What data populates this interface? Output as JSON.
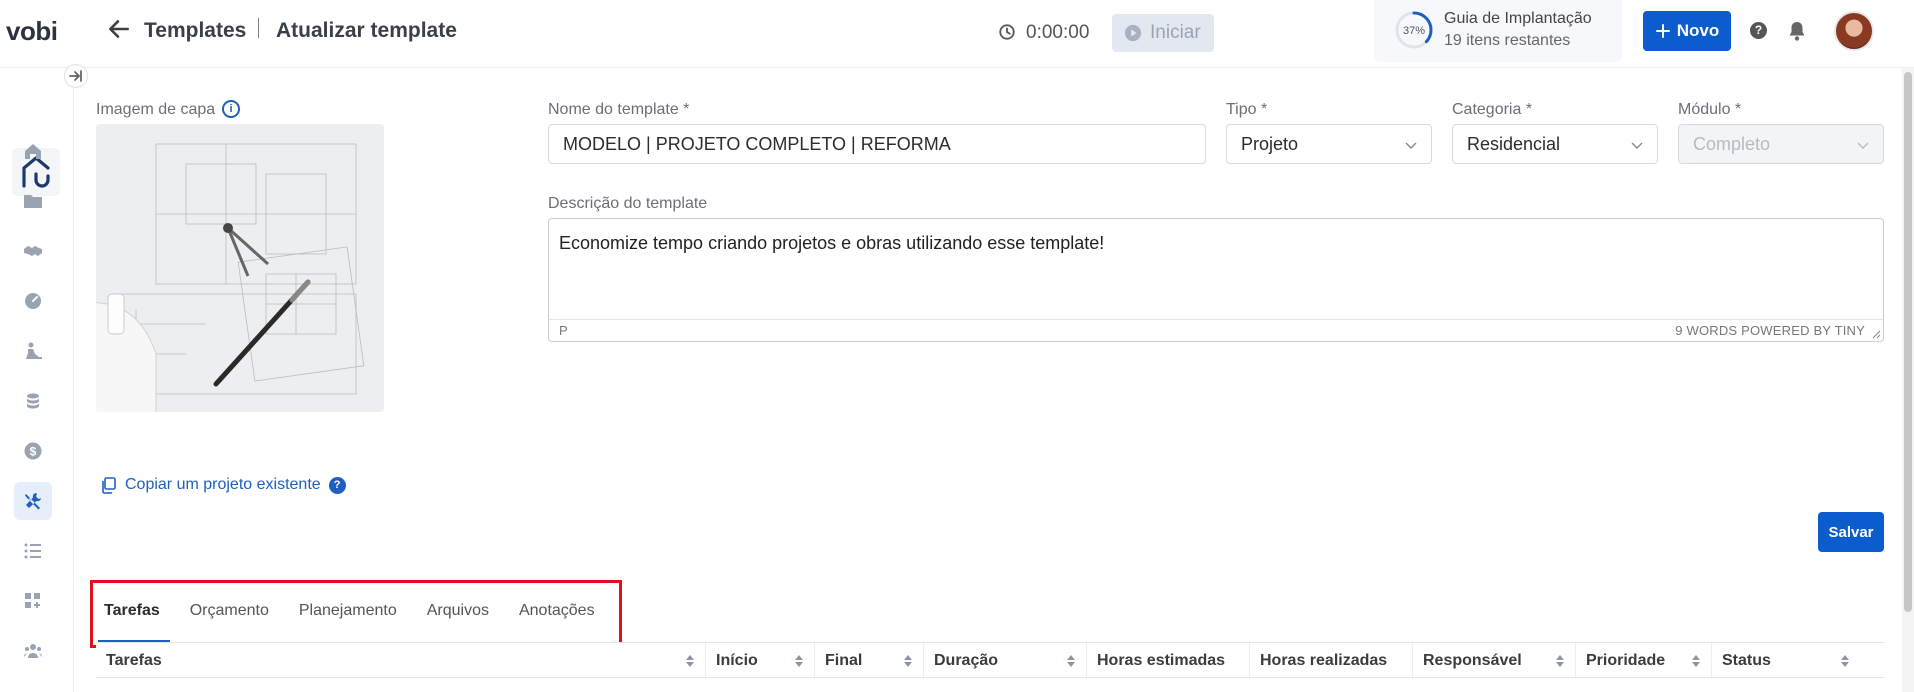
{
  "header": {
    "logo": "vobi",
    "breadcrumb": [
      "Templates",
      "Atualizar template"
    ],
    "timer": "0:00:00",
    "start_label": "Iniciar",
    "guide": {
      "percent": "37%",
      "progress": 0.37,
      "title": "Guia de Implantação",
      "subtitle": "19 itens restantes"
    },
    "new_label": "Novo",
    "help_label": "?"
  },
  "sidebar": {
    "items": [
      {
        "icon": "home-icon"
      },
      {
        "icon": "folder-icon"
      },
      {
        "icon": "handshake-icon"
      },
      {
        "icon": "gauge-icon"
      },
      {
        "icon": "worker-icon"
      },
      {
        "icon": "coins-icon"
      },
      {
        "icon": "dollar-icon"
      },
      {
        "icon": "tools-icon",
        "active": true
      },
      {
        "icon": "list-icon"
      },
      {
        "icon": "apps-add-icon"
      },
      {
        "icon": "team-icon"
      }
    ]
  },
  "form": {
    "cover_label": "Imagem de capa",
    "name_label": "Nome do template *",
    "name_value": "MODELO | PROJETO COMPLETO | REFORMA",
    "type_label": "Tipo *",
    "type_value": "Projeto",
    "category_label": "Categoria *",
    "category_value": "Residencial",
    "module_label": "Módulo *",
    "module_value": "Completo",
    "description_label": "Descrição do template",
    "description_value": "Economize tempo criando projetos e obras utilizando esse template!",
    "editor_path": "P",
    "editor_status": "9 WORDS  POWERED BY TINY",
    "copy_label": "Copiar um projeto existente",
    "save_label": "Salvar"
  },
  "tabs": [
    {
      "label": "Tarefas",
      "active": true
    },
    {
      "label": "Orçamento"
    },
    {
      "label": "Planejamento"
    },
    {
      "label": "Arquivos"
    },
    {
      "label": "Anotações"
    }
  ],
  "table": {
    "columns": [
      "Tarefas",
      "Início",
      "Final",
      "Duração",
      "Horas estimadas",
      "Horas realizadas",
      "Responsável",
      "Prioridade",
      "Status"
    ]
  },
  "colors": {
    "primary": "#0b5ccc",
    "highlight": "#e0111c"
  }
}
